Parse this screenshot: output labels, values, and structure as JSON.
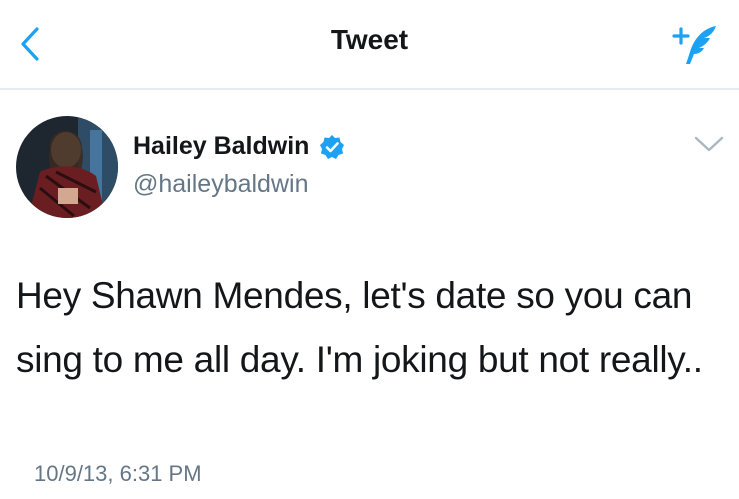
{
  "nav": {
    "title": "Tweet",
    "back_icon": "chevron-left-icon",
    "compose_icon": "compose-tweet-icon"
  },
  "tweet": {
    "author_name": "Hailey Baldwin",
    "handle": "@haileybaldwin",
    "verified_icon": "verified-badge-icon",
    "text": "Hey Shawn Mendes, let's date so you can sing to me all day. I'm joking but not really..",
    "timestamp": "10/9/13, 6:31 PM"
  },
  "colors": {
    "accent": "#1da1f2",
    "text": "#14171a",
    "secondary": "#657786",
    "divider": "#e6ecf0"
  }
}
